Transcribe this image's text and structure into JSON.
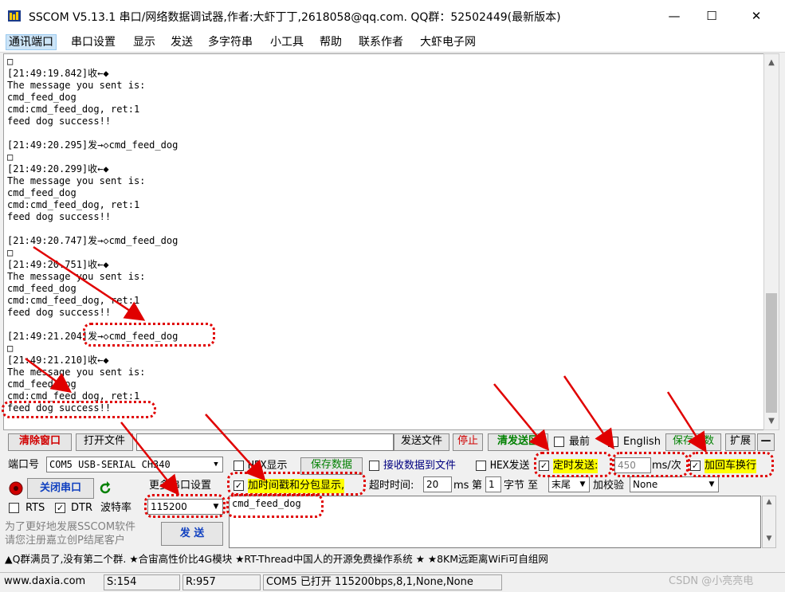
{
  "window": {
    "title": "SSCOM V5.13.1 串口/网络数据调试器,作者:大虾丁丁,2618058@qq.com. QQ群：52502449(最新版本)",
    "minimize": "—",
    "maximize": "☐",
    "close": "✕"
  },
  "menu": [
    "通讯端口",
    "串口设置",
    "显示",
    "发送",
    "多字符串",
    "小工具",
    "帮助",
    "联系作者",
    "大虾电子网"
  ],
  "log_lines": [
    "□",
    "[21:49:19.842]收←◆",
    "The message you sent is:",
    "cmd_feed_dog",
    "cmd:cmd_feed_dog, ret:1",
    "feed dog success!!",
    "",
    "[21:49:20.295]发→◇cmd_feed_dog",
    "□",
    "[21:49:20.299]收←◆",
    "The message you sent is:",
    "cmd_feed_dog",
    "cmd:cmd_feed_dog, ret:1",
    "feed dog success!!",
    "",
    "[21:49:20.747]发→◇cmd_feed_dog",
    "□",
    "[21:49:20.751]收←◆",
    "The message you sent is:",
    "cmd_feed_dog",
    "cmd:cmd_feed_dog, ret:1",
    "feed dog success!!",
    "",
    "[21:49:21.204]发→◇cmd_feed_dog",
    "□",
    "[21:49:21.210]收←◆",
    "The message you sent is:",
    "cmd_feed_dog",
    "cmd:cmd_feed_dog, ret:1",
    "feed dog success!!"
  ],
  "toolbar": {
    "clear_window": "清除窗口",
    "open_file": "打开文件",
    "send_file": "发送文件",
    "stop": "停止",
    "clear_send": "清发送区",
    "topmost": "最前",
    "english": "English",
    "save_params": "保存参数",
    "expand": "扩展",
    "collapse": "—"
  },
  "port": {
    "port_label": "端口号",
    "port_value": "COM5 USB-SERIAL CH340",
    "close_port": "关闭串口",
    "more_settings": "更多串口设置",
    "rts": "RTS",
    "dtr": "DTR",
    "baud_label": "波特率",
    "baud_value": "115200"
  },
  "options": {
    "hex_display": "HEX显示",
    "save_data": "保存数据",
    "recv_to_file": "接收数据到文件",
    "hex_send": "HEX发送",
    "timed_send": "定时发送:",
    "interval": "450",
    "interval_unit": "ms/次",
    "add_crlf": "加回车换行",
    "add_timestamp": "加时间戳和分包显示,",
    "timeout_label": "超时时间:",
    "timeout_value": "20",
    "timeout_unit": "ms",
    "page_label": "第",
    "byte_index": "1",
    "byte_label": "字节 至",
    "end_value": "末尾",
    "checksum_label": "加校验",
    "checksum_value": "None"
  },
  "send": {
    "text": "cmd_feed_dog",
    "button": "发 送",
    "promo": "为了更好地发展SSCOM软件\n请您注册嘉立创P结尾客户"
  },
  "ticker": "▲Q群满员了,没有第二个群. ★合宙高性价比4G模块 ★RT-Thread中国人的开源免费操作系统 ★ ★8KM远距离WiFi可自组网",
  "status": {
    "site": "www.daxia.com",
    "sent": "S:154",
    "received": "R:957",
    "port_state": "COM5 已打开  115200bps,8,1,None,None",
    "watermark": "CSDN @小亮亮电"
  },
  "colors": {
    "highlight_box": "#e00000",
    "yellow_label": "#ffff00",
    "green_label": "#008000"
  }
}
